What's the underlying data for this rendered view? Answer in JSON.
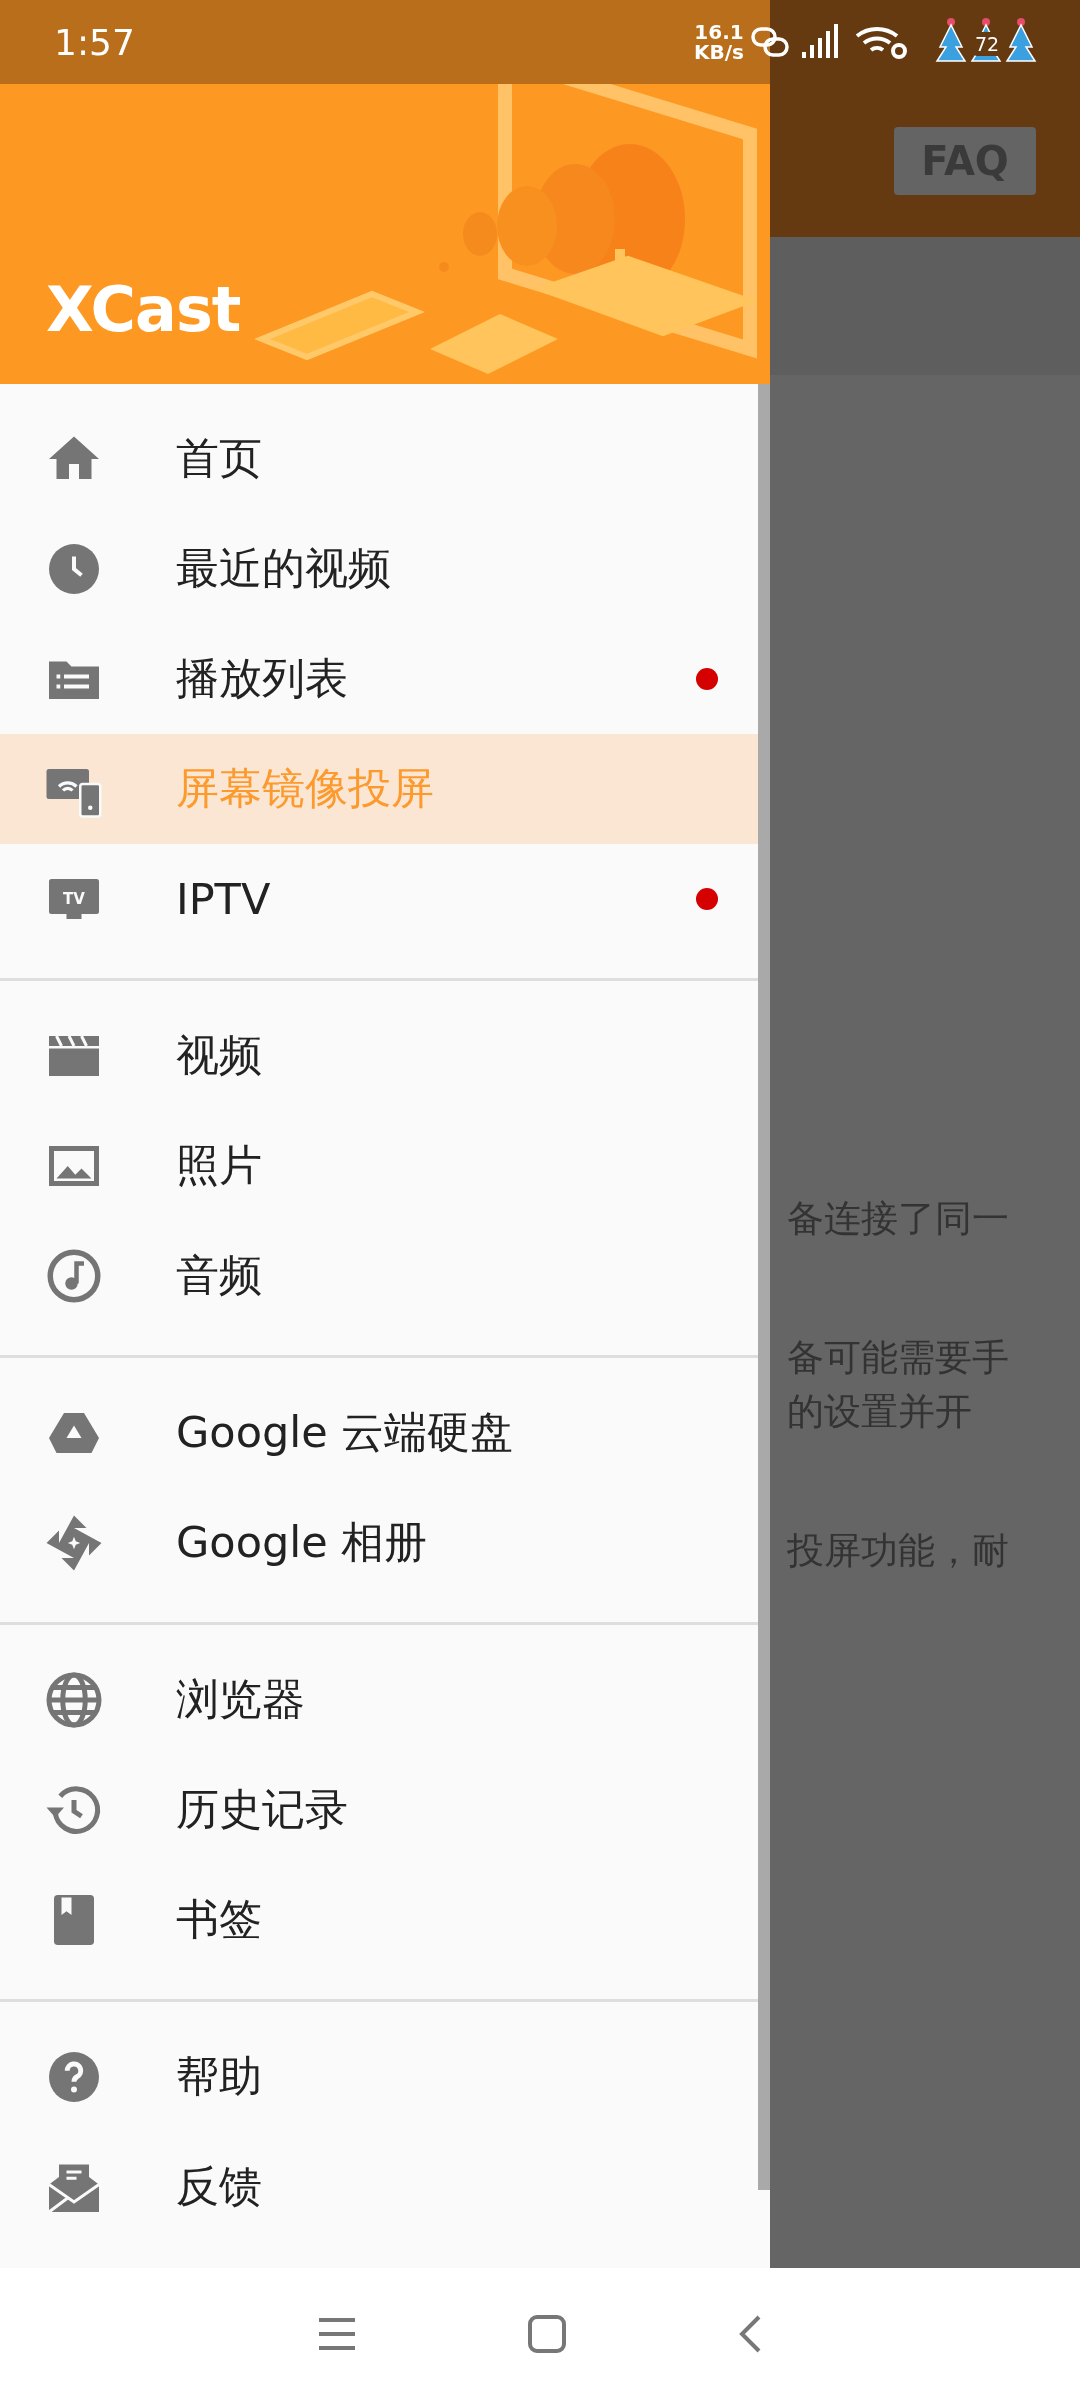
{
  "status_bar": {
    "time": "1:57",
    "net_speed": "16.1",
    "net_unit": "KB/s",
    "battery": "72"
  },
  "drawer": {
    "logo": "XCast",
    "sections": [
      {
        "items": [
          {
            "label": "首页",
            "kind": "home",
            "selected": false,
            "badge": false
          },
          {
            "label": "最近的视频",
            "kind": "clock",
            "selected": false,
            "badge": false
          },
          {
            "label": "播放列表",
            "kind": "playlist",
            "selected": false,
            "badge": true
          },
          {
            "label": "屏幕镜像投屏",
            "kind": "mirror",
            "selected": true,
            "badge": false
          },
          {
            "label": "IPTV",
            "kind": "tv",
            "icon_text": "TV",
            "selected": false,
            "badge": true
          }
        ]
      },
      {
        "items": [
          {
            "label": "视频",
            "kind": "movie",
            "selected": false,
            "badge": false
          },
          {
            "label": "照片",
            "kind": "image",
            "selected": false,
            "badge": false
          },
          {
            "label": "音频",
            "kind": "audio",
            "selected": false,
            "badge": false
          }
        ]
      },
      {
        "items": [
          {
            "label": "Google 云端硬盘",
            "kind": "drive",
            "selected": false,
            "badge": false
          },
          {
            "label": "Google 相册",
            "kind": "pinwheel",
            "selected": false,
            "badge": false
          }
        ]
      },
      {
        "items": [
          {
            "label": "浏览器",
            "kind": "globe",
            "selected": false,
            "badge": false
          },
          {
            "label": "历史记录",
            "kind": "history",
            "selected": false,
            "badge": false
          },
          {
            "label": "书签",
            "kind": "bookmark",
            "selected": false,
            "badge": false
          }
        ]
      },
      {
        "items": [
          {
            "label": "帮助",
            "kind": "help",
            "selected": false,
            "badge": false
          },
          {
            "label": "反馈",
            "kind": "feedback",
            "selected": false,
            "badge": false
          }
        ]
      }
    ]
  },
  "background": {
    "faq_button": "FAQ",
    "paragraphs": [
      [
        "备连接了同一"
      ],
      [
        "备可能需要手",
        "的设置并开"
      ],
      [
        "投屏功能，耐"
      ]
    ]
  }
}
